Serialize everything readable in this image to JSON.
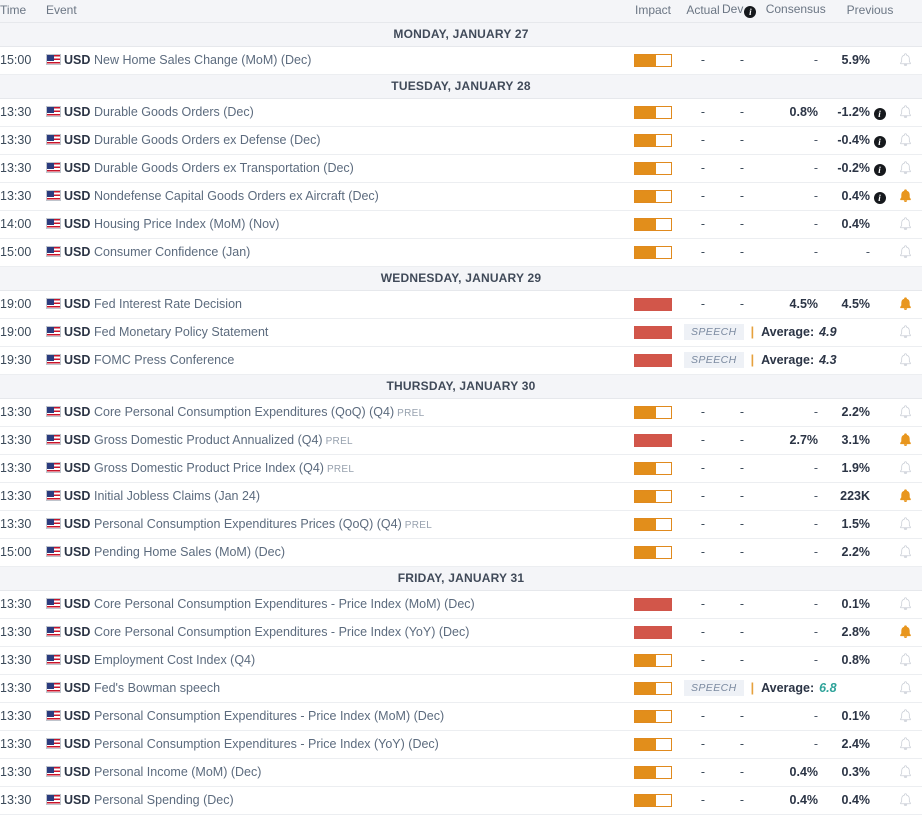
{
  "columns": {
    "time": "Time",
    "event": "Event",
    "impact": "Impact",
    "actual": "Actual",
    "dev": "Dev",
    "dev_info_icon": "info-icon",
    "consensus": "Consensus",
    "previous": "Previous"
  },
  "colors": {
    "impact_medium": "#e28e1b",
    "impact_high": "#d2564a",
    "alert_active": "#e8961e",
    "alert_inactive": "#c9ced6",
    "day_band_bg": "#f4f5f8",
    "text_primary": "#2b3445",
    "text_event": "#5c6b7e",
    "avg_teal": "#2fa39a",
    "speech_badge_bg": "#eef1f6",
    "speech_badge_text": "#7b8aa0"
  },
  "placeholders": {
    "empty": "-"
  },
  "days": [
    {
      "label": "MONDAY, JANUARY 27",
      "events": [
        {
          "time": "15:00",
          "currency": "USD",
          "flag": "us-flag-icon",
          "name": "New Home Sales Change (MoM) (Dec)",
          "tag": "",
          "impact": "medium",
          "type": "data",
          "actual": "-",
          "dev": "-",
          "consensus": "-",
          "previous": "5.9%",
          "info": false,
          "alert": false
        }
      ]
    },
    {
      "label": "TUESDAY, JANUARY 28",
      "events": [
        {
          "time": "13:30",
          "currency": "USD",
          "flag": "us-flag-icon",
          "name": "Durable Goods Orders (Dec)",
          "tag": "",
          "impact": "medium",
          "type": "data",
          "actual": "-",
          "dev": "-",
          "consensus": "0.8%",
          "previous": "-1.2%",
          "info": true,
          "alert": false
        },
        {
          "time": "13:30",
          "currency": "USD",
          "flag": "us-flag-icon",
          "name": "Durable Goods Orders ex Defense (Dec)",
          "tag": "",
          "impact": "medium",
          "type": "data",
          "actual": "-",
          "dev": "-",
          "consensus": "-",
          "previous": "-0.4%",
          "info": true,
          "alert": false
        },
        {
          "time": "13:30",
          "currency": "USD",
          "flag": "us-flag-icon",
          "name": "Durable Goods Orders ex Transportation (Dec)",
          "tag": "",
          "impact": "medium",
          "type": "data",
          "actual": "-",
          "dev": "-",
          "consensus": "-",
          "previous": "-0.2%",
          "info": true,
          "alert": false
        },
        {
          "time": "13:30",
          "currency": "USD",
          "flag": "us-flag-icon",
          "name": "Nondefense Capital Goods Orders ex Aircraft (Dec)",
          "tag": "",
          "impact": "medium",
          "type": "data",
          "actual": "-",
          "dev": "-",
          "consensus": "-",
          "previous": "0.4%",
          "info": true,
          "alert": true
        },
        {
          "time": "14:00",
          "currency": "USD",
          "flag": "us-flag-icon",
          "name": "Housing Price Index (MoM) (Nov)",
          "tag": "",
          "impact": "medium",
          "type": "data",
          "actual": "-",
          "dev": "-",
          "consensus": "-",
          "previous": "0.4%",
          "info": false,
          "alert": false
        },
        {
          "time": "15:00",
          "currency": "USD",
          "flag": "us-flag-icon",
          "name": "Consumer Confidence (Jan)",
          "tag": "",
          "impact": "medium",
          "type": "data",
          "actual": "-",
          "dev": "-",
          "consensus": "-",
          "previous": "-",
          "info": false,
          "alert": false
        }
      ]
    },
    {
      "label": "WEDNESDAY, JANUARY 29",
      "events": [
        {
          "time": "19:00",
          "currency": "USD",
          "flag": "us-flag-icon",
          "name": "Fed Interest Rate Decision",
          "tag": "",
          "impact": "high",
          "type": "data",
          "actual": "-",
          "dev": "-",
          "consensus": "4.5%",
          "previous": "4.5%",
          "info": false,
          "alert": true
        },
        {
          "time": "19:00",
          "currency": "USD",
          "flag": "us-flag-icon",
          "name": "Fed Monetary Policy Statement",
          "tag": "",
          "impact": "high",
          "type": "speech",
          "speech_label": "SPEECH",
          "average_label": "Average:",
          "average_value": "4.9",
          "average_color": "dark",
          "info": false,
          "alert": false
        },
        {
          "time": "19:30",
          "currency": "USD",
          "flag": "us-flag-icon",
          "name": "FOMC Press Conference",
          "tag": "",
          "impact": "high",
          "type": "speech",
          "speech_label": "SPEECH",
          "average_label": "Average:",
          "average_value": "4.3",
          "average_color": "dark",
          "info": false,
          "alert": false
        }
      ]
    },
    {
      "label": "THURSDAY, JANUARY 30",
      "events": [
        {
          "time": "13:30",
          "currency": "USD",
          "flag": "us-flag-icon",
          "name": "Core Personal Consumption Expenditures (QoQ) (Q4)",
          "tag": "PREL",
          "impact": "medium",
          "type": "data",
          "actual": "-",
          "dev": "-",
          "consensus": "-",
          "previous": "2.2%",
          "info": false,
          "alert": false
        },
        {
          "time": "13:30",
          "currency": "USD",
          "flag": "us-flag-icon",
          "name": "Gross Domestic Product Annualized (Q4)",
          "tag": "PREL",
          "impact": "high",
          "type": "data",
          "actual": "-",
          "dev": "-",
          "consensus": "2.7%",
          "previous": "3.1%",
          "info": false,
          "alert": true
        },
        {
          "time": "13:30",
          "currency": "USD",
          "flag": "us-flag-icon",
          "name": "Gross Domestic Product Price Index (Q4)",
          "tag": "PREL",
          "impact": "medium",
          "type": "data",
          "actual": "-",
          "dev": "-",
          "consensus": "-",
          "previous": "1.9%",
          "info": false,
          "alert": false
        },
        {
          "time": "13:30",
          "currency": "USD",
          "flag": "us-flag-icon",
          "name": "Initial Jobless Claims (Jan 24)",
          "tag": "",
          "impact": "medium",
          "type": "data",
          "actual": "-",
          "dev": "-",
          "consensus": "-",
          "previous": "223K",
          "info": false,
          "alert": true
        },
        {
          "time": "13:30",
          "currency": "USD",
          "flag": "us-flag-icon",
          "name": "Personal Consumption Expenditures Prices (QoQ) (Q4)",
          "tag": "PREL",
          "impact": "medium",
          "type": "data",
          "actual": "-",
          "dev": "-",
          "consensus": "-",
          "previous": "1.5%",
          "info": false,
          "alert": false
        },
        {
          "time": "15:00",
          "currency": "USD",
          "flag": "us-flag-icon",
          "name": "Pending Home Sales (MoM) (Dec)",
          "tag": "",
          "impact": "medium",
          "type": "data",
          "actual": "-",
          "dev": "-",
          "consensus": "-",
          "previous": "2.2%",
          "info": false,
          "alert": false
        }
      ]
    },
    {
      "label": "FRIDAY, JANUARY 31",
      "events": [
        {
          "time": "13:30",
          "currency": "USD",
          "flag": "us-flag-icon",
          "name": "Core Personal Consumption Expenditures - Price Index (MoM) (Dec)",
          "tag": "",
          "impact": "high",
          "type": "data",
          "actual": "-",
          "dev": "-",
          "consensus": "-",
          "previous": "0.1%",
          "info": false,
          "alert": false
        },
        {
          "time": "13:30",
          "currency": "USD",
          "flag": "us-flag-icon",
          "name": "Core Personal Consumption Expenditures - Price Index (YoY) (Dec)",
          "tag": "",
          "impact": "high",
          "type": "data",
          "actual": "-",
          "dev": "-",
          "consensus": "-",
          "previous": "2.8%",
          "info": false,
          "alert": true
        },
        {
          "time": "13:30",
          "currency": "USD",
          "flag": "us-flag-icon",
          "name": "Employment Cost Index (Q4)",
          "tag": "",
          "impact": "medium",
          "type": "data",
          "actual": "-",
          "dev": "-",
          "consensus": "-",
          "previous": "0.8%",
          "info": false,
          "alert": false
        },
        {
          "time": "13:30",
          "currency": "USD",
          "flag": "us-flag-icon",
          "name": "Fed's Bowman speech",
          "tag": "",
          "impact": "medium",
          "type": "speech",
          "speech_label": "SPEECH",
          "average_label": "Average:",
          "average_value": "6.8",
          "average_color": "teal",
          "info": false,
          "alert": false
        },
        {
          "time": "13:30",
          "currency": "USD",
          "flag": "us-flag-icon",
          "name": "Personal Consumption Expenditures - Price Index (MoM) (Dec)",
          "tag": "",
          "impact": "medium",
          "type": "data",
          "actual": "-",
          "dev": "-",
          "consensus": "-",
          "previous": "0.1%",
          "info": false,
          "alert": false
        },
        {
          "time": "13:30",
          "currency": "USD",
          "flag": "us-flag-icon",
          "name": "Personal Consumption Expenditures - Price Index (YoY) (Dec)",
          "tag": "",
          "impact": "medium",
          "type": "data",
          "actual": "-",
          "dev": "-",
          "consensus": "-",
          "previous": "2.4%",
          "info": false,
          "alert": false
        },
        {
          "time": "13:30",
          "currency": "USD",
          "flag": "us-flag-icon",
          "name": "Personal Income (MoM) (Dec)",
          "tag": "",
          "impact": "medium",
          "type": "data",
          "actual": "-",
          "dev": "-",
          "consensus": "0.4%",
          "previous": "0.3%",
          "info": false,
          "alert": false
        },
        {
          "time": "13:30",
          "currency": "USD",
          "flag": "us-flag-icon",
          "name": "Personal Spending (Dec)",
          "tag": "",
          "impact": "medium",
          "type": "data",
          "actual": "-",
          "dev": "-",
          "consensus": "0.4%",
          "previous": "0.4%",
          "info": false,
          "alert": false
        }
      ]
    }
  ]
}
